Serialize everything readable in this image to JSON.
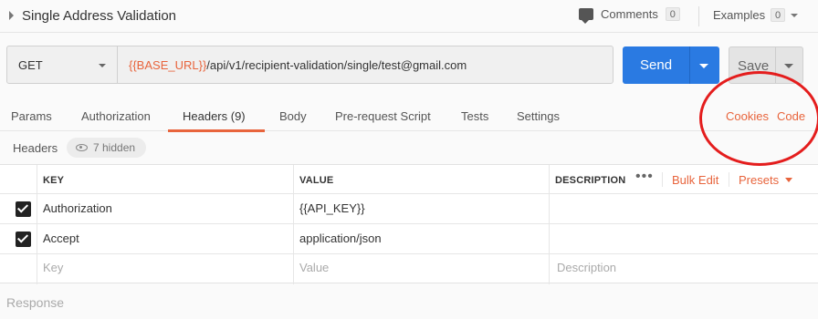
{
  "header": {
    "title": "Single Address Validation",
    "comments_label": "Comments",
    "comments_count": "0",
    "examples_label": "Examples",
    "examples_count": "0"
  },
  "request": {
    "method": "GET",
    "url_var": "{{BASE_URL}}",
    "url_path": "/api/v1/recipient-validation/single/test@gmail.com",
    "send_label": "Send",
    "save_label": "Save"
  },
  "tabs": [
    {
      "label": "Params"
    },
    {
      "label": "Authorization"
    },
    {
      "label": "Headers (9)",
      "active": true
    },
    {
      "label": "Body"
    },
    {
      "label": "Pre-request Script"
    },
    {
      "label": "Tests"
    },
    {
      "label": "Settings"
    }
  ],
  "tab_links": {
    "cookies": "Cookies",
    "code": "Code"
  },
  "headers_section": {
    "title": "Headers",
    "hidden_label": "7 hidden"
  },
  "table": {
    "columns": {
      "key": "KEY",
      "value": "VALUE",
      "description": "DESCRIPTION"
    },
    "bulk_edit": "Bulk Edit",
    "presets": "Presets",
    "rows": [
      {
        "checked": true,
        "key": "Authorization",
        "value": "{{API_KEY}}",
        "value_is_var": true,
        "description": ""
      },
      {
        "checked": true,
        "key": "Accept",
        "value": "application/json",
        "value_is_var": false,
        "description": ""
      }
    ],
    "placeholders": {
      "key": "Key",
      "value": "Value",
      "description": "Description"
    }
  },
  "response_label": "Response",
  "colors": {
    "accent": "#e8643c",
    "send": "#2a7ae2",
    "annotation": "#e41d1d"
  }
}
